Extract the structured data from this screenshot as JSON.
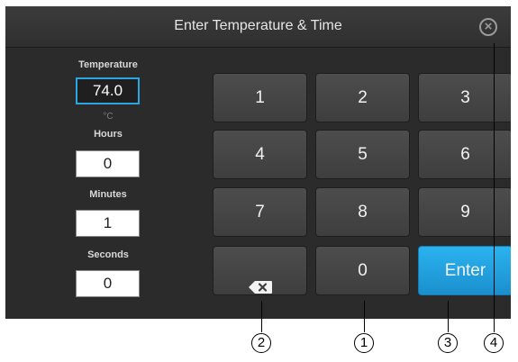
{
  "header": {
    "title": "Enter Temperature & Time",
    "close_symbol": "×"
  },
  "fields": {
    "temperature": {
      "label": "Temperature",
      "value": "74.0",
      "unit": "°C"
    },
    "hours": {
      "label": "Hours",
      "value": "0"
    },
    "minutes": {
      "label": "Minutes",
      "value": "1"
    },
    "seconds": {
      "label": "Seconds",
      "value": "0"
    }
  },
  "keypad": {
    "keys": [
      "1",
      "2",
      "3",
      "4",
      "5",
      "6",
      "7",
      "8",
      "9"
    ],
    "zero": "0",
    "enter": "Enter",
    "backspace_icon": "backspace-icon"
  },
  "callouts": [
    "1",
    "2",
    "3",
    "4"
  ],
  "colors": {
    "accent": "#2aa6e0",
    "enter_button": "#1f9ad8",
    "background": "#2b2b2b"
  }
}
